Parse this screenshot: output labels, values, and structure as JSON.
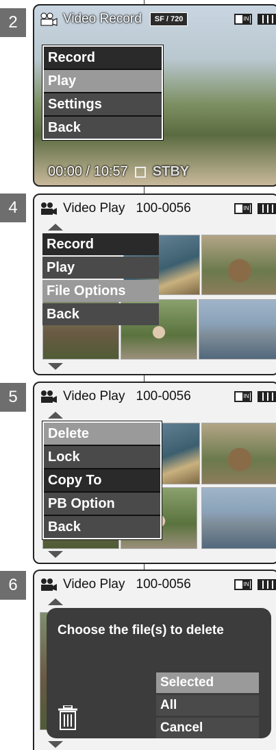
{
  "steps": [
    {
      "number": "2",
      "title": "Video Record",
      "resolution": "SF / 720",
      "menu": [
        "Record",
        "Play",
        "Settings",
        "Back"
      ],
      "time": "00:00 / 10:57",
      "status": "STBY"
    },
    {
      "number": "4",
      "title": "Video Play",
      "file_no": "100-0056",
      "menu": [
        "Record",
        "Play",
        "File Options",
        "Back"
      ]
    },
    {
      "number": "5",
      "title": "Video Play",
      "file_no": "100-0056",
      "menu": [
        "Delete",
        "Lock",
        "Copy To",
        "PB Option",
        "Back"
      ]
    },
    {
      "number": "6",
      "title": "Video Play",
      "file_no": "100-0056",
      "dialog_title": "Choose the file(s) to delete",
      "options": [
        "Selected",
        "All",
        "Cancel"
      ]
    }
  ],
  "icons": [
    "camcorder-icon",
    "memory-in-icon",
    "battery-icon",
    "trash-icon",
    "scroll-up-icon",
    "scroll-down-icon"
  ],
  "colors": {
    "menu_dark": "#2a2a2a",
    "menu_mid": "#4a4a4a",
    "menu_selected": "#9a9a9a",
    "dialog_bg": "#3c3c3c"
  }
}
